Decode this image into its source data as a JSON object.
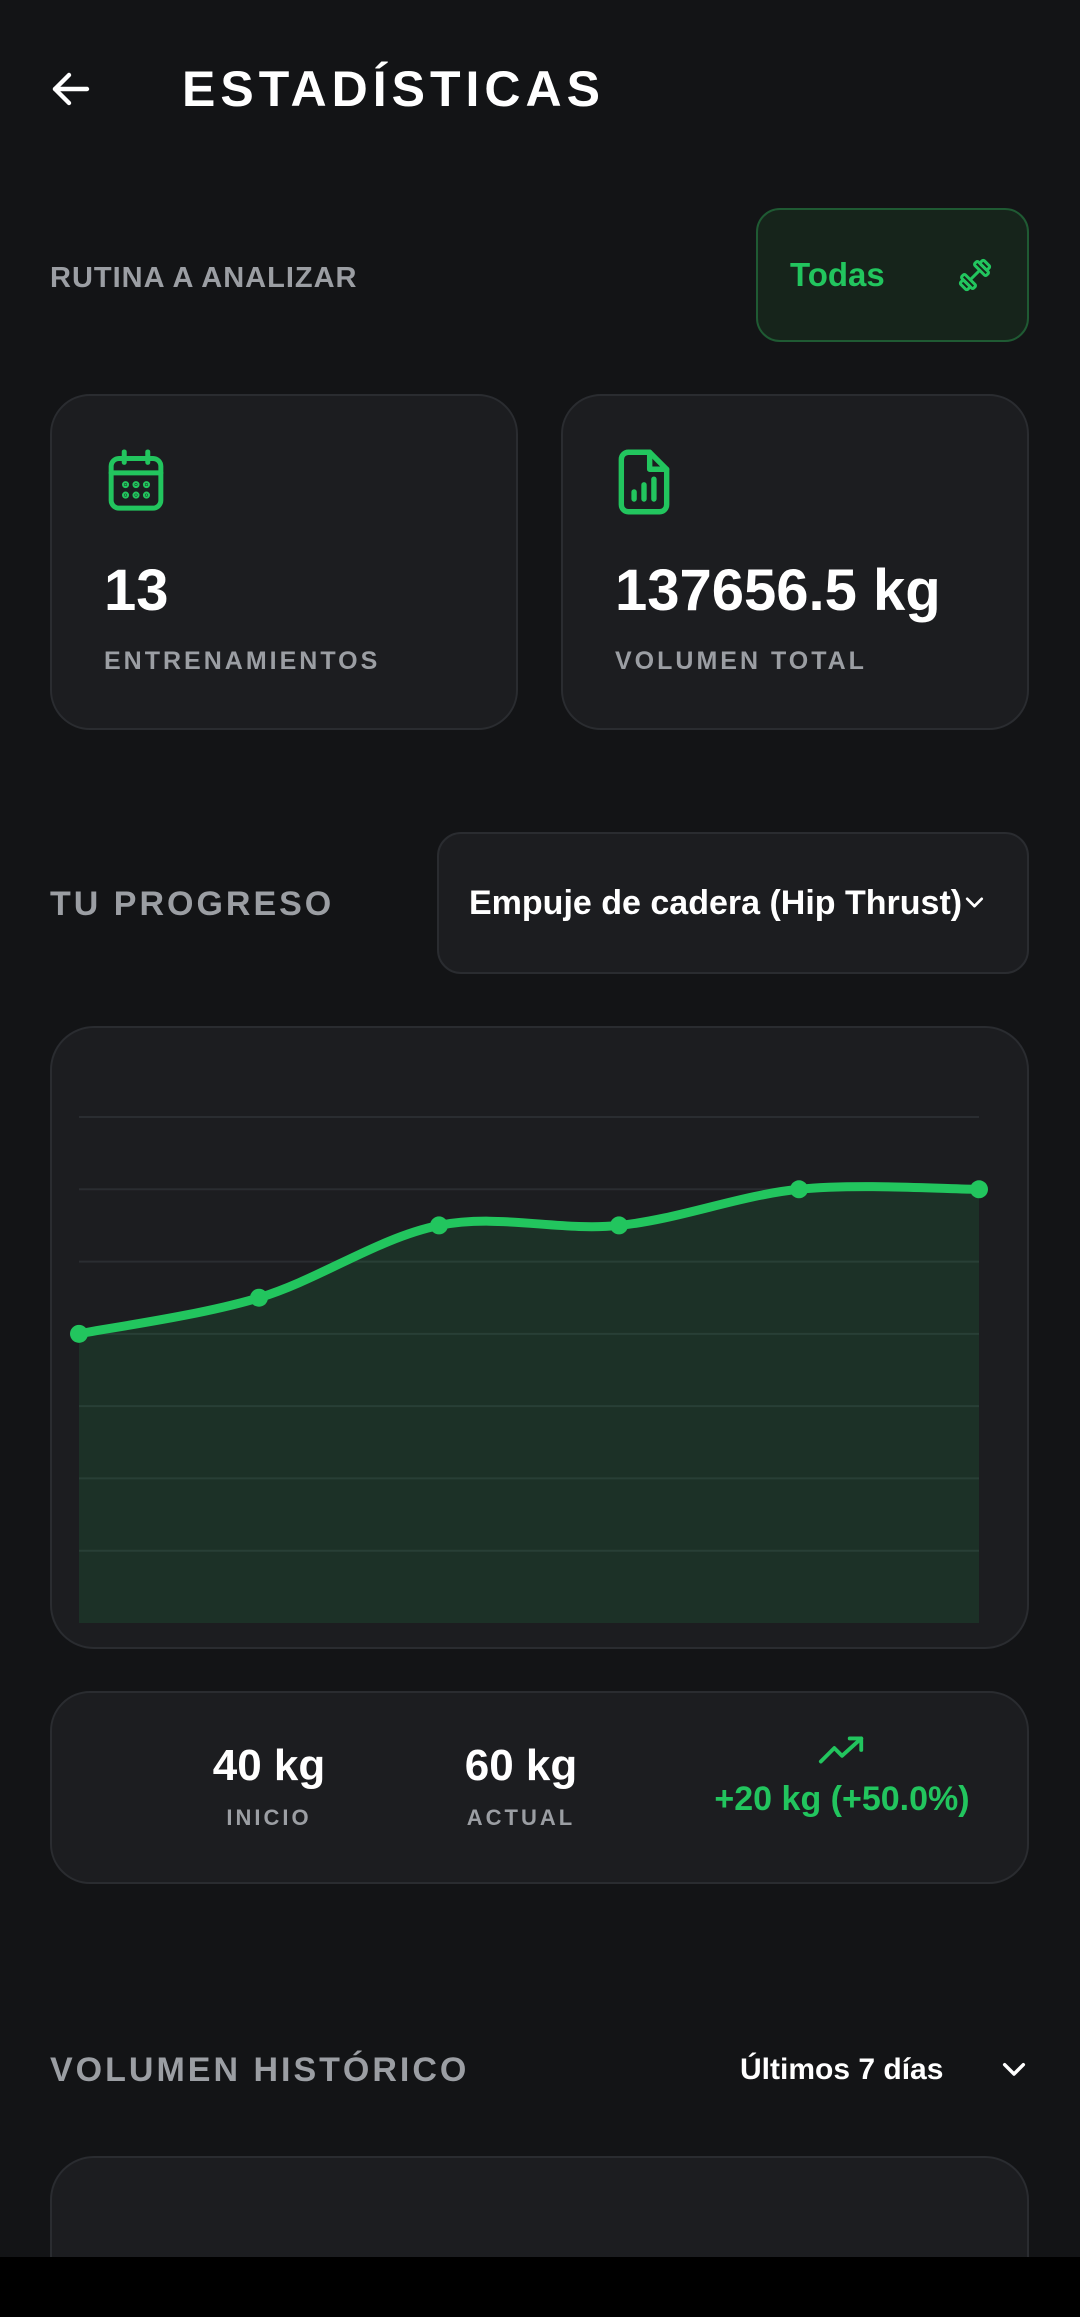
{
  "header": {
    "title": "ESTADÍSTICAS",
    "back_icon": "arrow-left-icon"
  },
  "routine": {
    "label": "RUTINA A ANALIZAR",
    "selected": "Todas",
    "icon": "dumbbell-icon"
  },
  "stats": [
    {
      "value": "13",
      "label": "ENTRENAMIENTOS",
      "icon": "calendar-icon"
    },
    {
      "value": "137656.5 kg",
      "label": "VOLUMEN TOTAL",
      "icon": "file-chart-icon"
    }
  ],
  "progress": {
    "label": "TU PROGRESO",
    "exercise": "Empuje de cadera (Hip Thrust)"
  },
  "chart_data": {
    "type": "area",
    "x": [
      1,
      2,
      3,
      4,
      5,
      6
    ],
    "values": [
      40,
      45,
      55,
      55,
      60,
      60
    ],
    "ylim": [
      0,
      70
    ],
    "grid": true,
    "color": "#22c55e"
  },
  "summary": {
    "start_value": "40 kg",
    "start_label": "INICIO",
    "current_value": "60 kg",
    "current_label": "ACTUAL",
    "change": "+20 kg (+50.0%)",
    "change_icon": "trending-up-icon"
  },
  "volume": {
    "label": "VOLUMEN HISTÓRICO",
    "period": "Últimos 7 días"
  },
  "colors": {
    "accent": "#22c55e",
    "background": "#131416",
    "card": "#1c1d20"
  }
}
